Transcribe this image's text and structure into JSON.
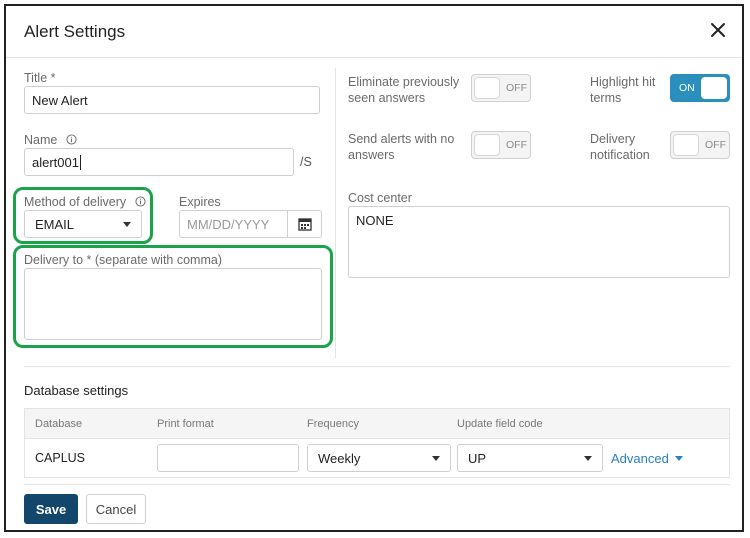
{
  "dialog": {
    "title": "Alert Settings"
  },
  "form": {
    "title_label": "Title *",
    "title_value": "New Alert",
    "name_label": "Name",
    "name_value": "alert001",
    "name_suffix": "/S",
    "method_label": "Method of delivery",
    "method_value": "EMAIL",
    "expires_label": "Expires",
    "expires_placeholder": "MM/DD/YYYY",
    "delivery_label": "Delivery to * (separate with comma)",
    "delivery_value": ""
  },
  "options": {
    "eliminate_label": "Eliminate previously seen answers",
    "eliminate_state": "OFF",
    "highlight_label": "Highlight hit terms",
    "highlight_state": "ON",
    "send_alerts_label": "Send alerts with no answers",
    "send_alerts_state": "OFF",
    "delivery_notification_label": "Delivery notification",
    "delivery_notification_state": "OFF",
    "cost_center_label": "Cost center",
    "cost_center_value": "NONE"
  },
  "database": {
    "section_title": "Database settings",
    "columns": [
      "Database",
      "Print format",
      "Frequency",
      "Update field code"
    ],
    "row": {
      "database": "CAPLUS",
      "print_format": "",
      "frequency": "Weekly",
      "update_field_code": "UP",
      "advanced_label": "Advanced"
    }
  },
  "buttons": {
    "save": "Save",
    "cancel": "Cancel"
  },
  "colors": {
    "primary_button": "#12466a",
    "toggle_on": "#2a8fbd",
    "highlight_outline": "#1aa34a",
    "link": "#2a7fbf"
  }
}
